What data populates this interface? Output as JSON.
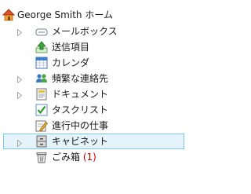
{
  "tree": {
    "root": {
      "label": "George Smith ホーム",
      "icon": "home-icon"
    },
    "items": [
      {
        "label": "メールボックス",
        "icon": "mailbox-icon",
        "expandable": true
      },
      {
        "label": "送信項目",
        "icon": "sent-items-icon",
        "expandable": false
      },
      {
        "label": "カレンダ",
        "icon": "calendar-icon",
        "expandable": false
      },
      {
        "label": "頻繁な連絡先",
        "icon": "contacts-icon",
        "expandable": true
      },
      {
        "label": "ドキュメント",
        "icon": "documents-icon",
        "expandable": true
      },
      {
        "label": "タスクリスト",
        "icon": "task-list-icon",
        "expandable": false
      },
      {
        "label": "進行中の仕事",
        "icon": "work-in-progress-icon",
        "expandable": false
      },
      {
        "label": "キャビネット",
        "icon": "cabinet-icon",
        "expandable": true,
        "selected": true
      },
      {
        "label": "ごみ箱",
        "icon": "trash-icon",
        "expandable": false,
        "count": "(1)"
      }
    ]
  },
  "colors": {
    "selection_bg": "#e5f3fb",
    "selection_border": "#7fc4ea",
    "count_text": "#c00000",
    "expander": "#a6a6a6"
  }
}
